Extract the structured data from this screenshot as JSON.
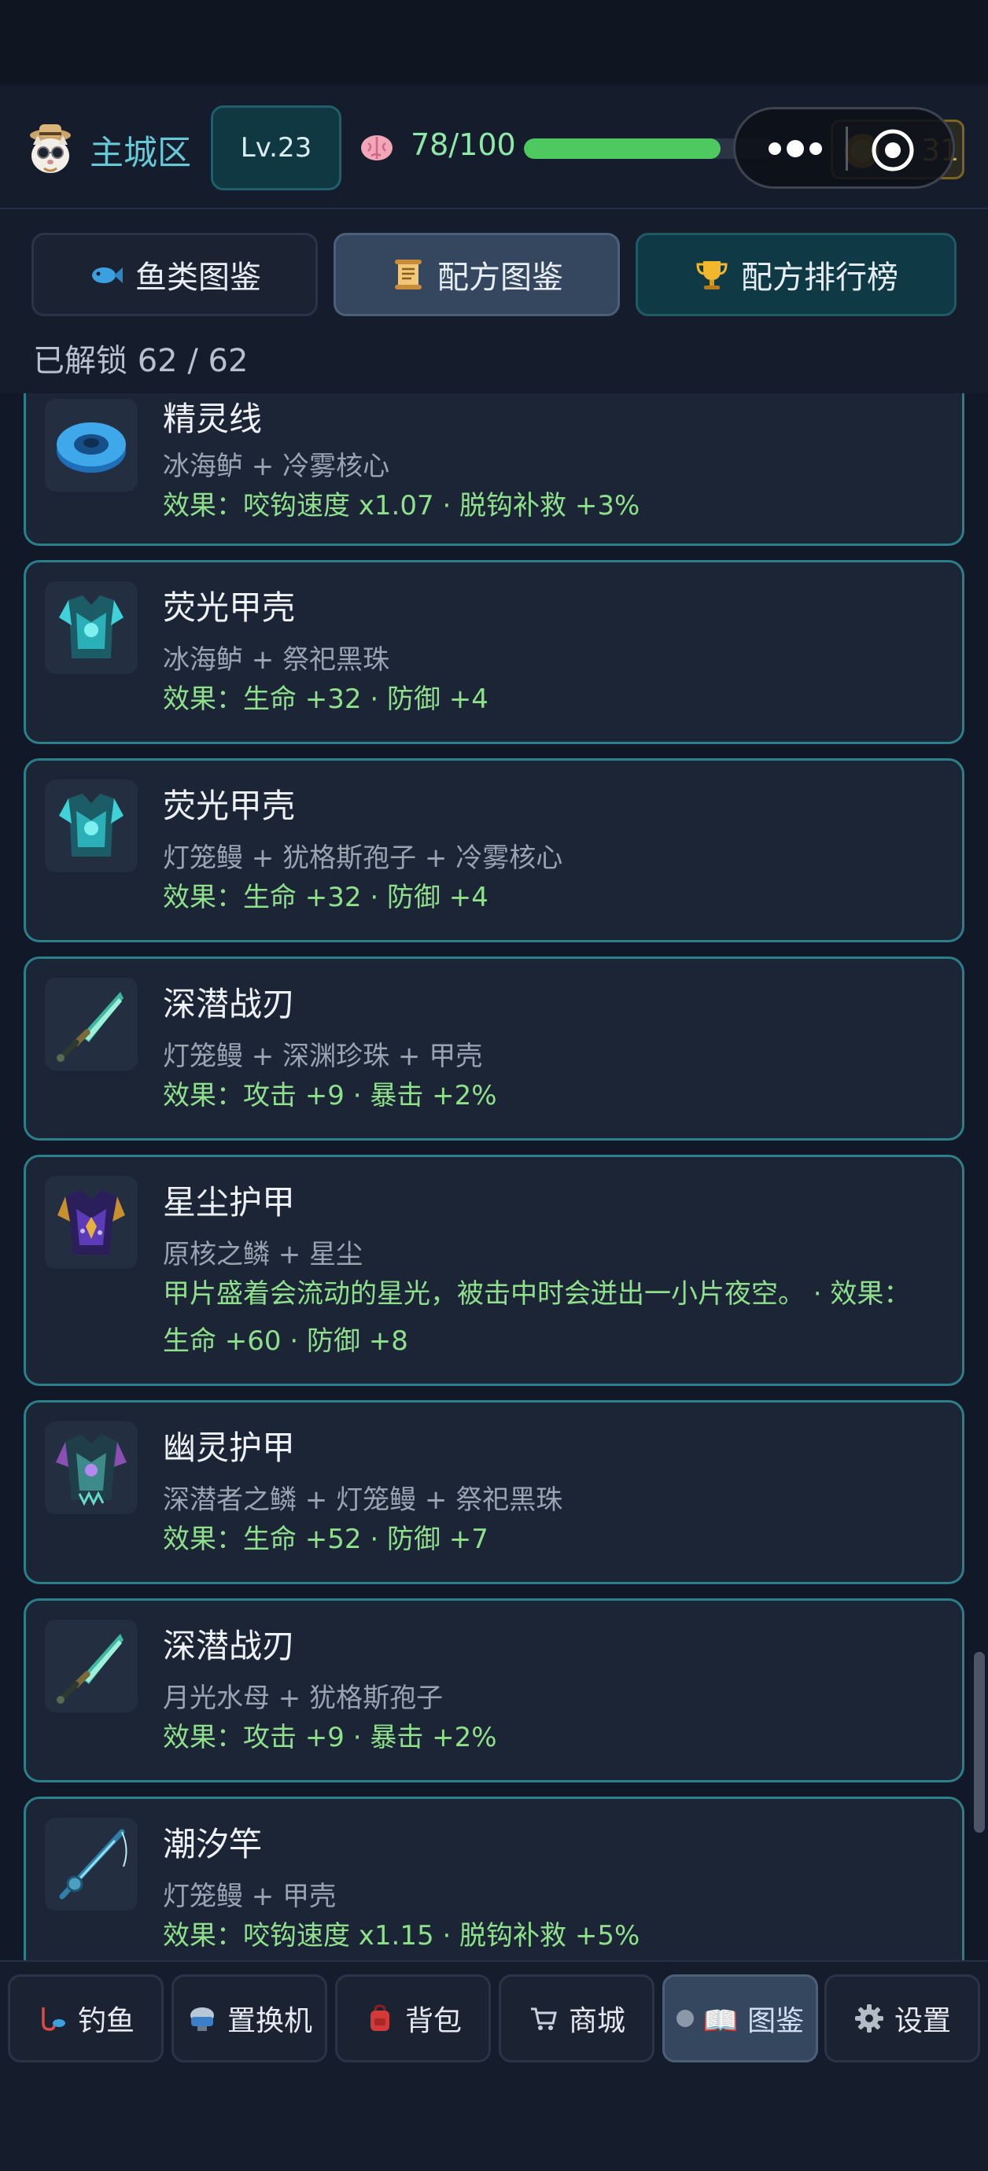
{
  "header": {
    "zone": "主城区",
    "level": "Lv.23",
    "stamina_text": "78/100",
    "stamina_fraction": 0.78,
    "coins": "31"
  },
  "tabs": {
    "fish": "鱼类图鉴",
    "recipe": "配方图鉴",
    "rank": "配方排行榜"
  },
  "unlock_text": "已解锁 62 / 62",
  "items": [
    {
      "name": "精灵线",
      "recipe": "冰海鲈 + 冷雾核心",
      "effect": "效果：咬钩速度 x1.07 · 脱钩补救 +3%",
      "icon": "spirit-line-icon"
    },
    {
      "name": "荧光甲壳",
      "recipe": "冰海鲈 + 祭祀黑珠",
      "effect": "效果：生命 +32 · 防御 +4",
      "icon": "glow-shell-armor-icon"
    },
    {
      "name": "荧光甲壳",
      "recipe": "灯笼鳗 + 犹格斯孢子 + 冷雾核心",
      "effect": "效果：生命 +32 · 防御 +4",
      "icon": "glow-shell-armor-icon"
    },
    {
      "name": "深潜战刃",
      "recipe": "灯笼鳗 + 深渊珍珠 + 甲壳",
      "effect": "效果：攻击 +9 · 暴击 +2%",
      "icon": "deep-dive-blade-icon"
    },
    {
      "name": "星尘护甲",
      "recipe": "原核之鳞 + 星尘",
      "effect": "甲片盛着会流动的星光，被击中时会迸出一小片夜空。 · 效果：生命 +60 · 防御 +8",
      "icon": "stardust-armor-icon"
    },
    {
      "name": "幽灵护甲",
      "recipe": "深潜者之鳞 + 灯笼鳗 + 祭祀黑珠",
      "effect": "效果：生命 +52 · 防御 +7",
      "icon": "ghost-armor-icon"
    },
    {
      "name": "深潜战刃",
      "recipe": "月光水母 + 犹格斯孢子",
      "effect": "效果：攻击 +9 · 暴击 +2%",
      "icon": "deep-dive-blade-icon"
    },
    {
      "name": "潮汐竿",
      "recipe": "灯笼鳗 + 甲壳",
      "effect": "效果：咬钩速度 x1.15 · 脱钩补救 +5%",
      "icon": "tide-rod-icon"
    }
  ],
  "nav": {
    "fishing": "钓鱼",
    "converter": "置换机",
    "bag": "背包",
    "shop": "商城",
    "codex": "📖 图鉴",
    "settings": "设置"
  }
}
